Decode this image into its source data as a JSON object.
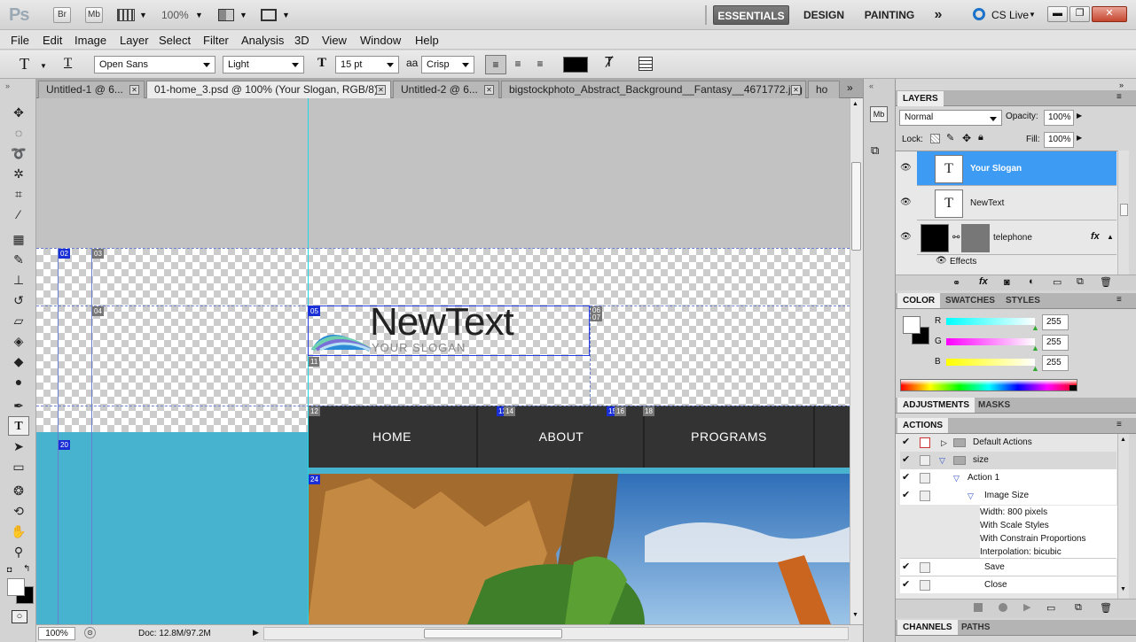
{
  "app": {
    "logo": "Ps",
    "bridge": "Br",
    "minibridge": "Mb",
    "zoom": "100%",
    "workspaces": [
      "ESSENTIALS",
      "DESIGN",
      "PAINTING"
    ],
    "more": "»",
    "cslive": "CS Live"
  },
  "menu": [
    "File",
    "Edit",
    "Image",
    "Layer",
    "Select",
    "Filter",
    "Analysis",
    "3D",
    "View",
    "Window",
    "Help"
  ],
  "options": {
    "font_family": "Open Sans",
    "font_style": "Light",
    "font_size": "15 pt",
    "antialias_label": "aa",
    "antialias": "Crisp",
    "color": "#000000"
  },
  "tabs": [
    {
      "label": "Untitled-1 @ 6..."
    },
    {
      "label": "01-home_3.psd @ 100% (Your Slogan, RGB/8) *"
    },
    {
      "label": "Untitled-2 @ 6..."
    },
    {
      "label": "bigstockphoto_Abstract_Background__Fantasy__4671772.jpg"
    },
    {
      "label": "ho"
    }
  ],
  "canvas": {
    "slices": [
      "02",
      "03",
      "04",
      "05",
      "07",
      "06",
      "11",
      "12",
      "13",
      "14",
      "15",
      "16",
      "18",
      "20",
      "24"
    ],
    "logo_text": "NewText",
    "slogan": "YOUR SLOGAN",
    "nav": [
      "HOME",
      "ABOUT",
      "PROGRAMS"
    ],
    "colors": {
      "teal": "#48b3cf",
      "nav": "#333333",
      "gray": "#c2c2c2"
    }
  },
  "status": {
    "zoom": "100%",
    "doc": "Doc: 12.8M/97.2M"
  },
  "layers": {
    "tab": "LAYERS",
    "blend": "Normal",
    "opacity_label": "Opacity:",
    "opacity": "100%",
    "lock_label": "Lock:",
    "fill_label": "Fill:",
    "fill": "100%",
    "items": [
      {
        "name": "Your Slogan",
        "selected": true
      },
      {
        "name": "NewText",
        "selected": false
      },
      {
        "name": "telephone",
        "selected": false
      }
    ],
    "effects": "Effects",
    "fx": "fx"
  },
  "color": {
    "tabs": [
      "COLOR",
      "SWATCHES",
      "STYLES"
    ],
    "channels": [
      {
        "label": "R",
        "value": "255"
      },
      {
        "label": "G",
        "value": "255"
      },
      {
        "label": "B",
        "value": "255"
      }
    ]
  },
  "adjust": {
    "tabs": [
      "ADJUSTMENTS",
      "MASKS"
    ]
  },
  "actions": {
    "tab": "ACTIONS",
    "rows": [
      {
        "label": "Default Actions"
      },
      {
        "label": "size"
      },
      {
        "label": "Action 1"
      },
      {
        "label": "Image Size"
      },
      {
        "label": "Width: 800 pixels"
      },
      {
        "label": "With Scale Styles"
      },
      {
        "label": "With Constrain Proportions"
      },
      {
        "label": "Interpolation: bicubic"
      },
      {
        "label": "Save"
      },
      {
        "label": "Close"
      }
    ]
  },
  "bottom": {
    "tabs": [
      "CHANNELS",
      "PATHS"
    ]
  }
}
